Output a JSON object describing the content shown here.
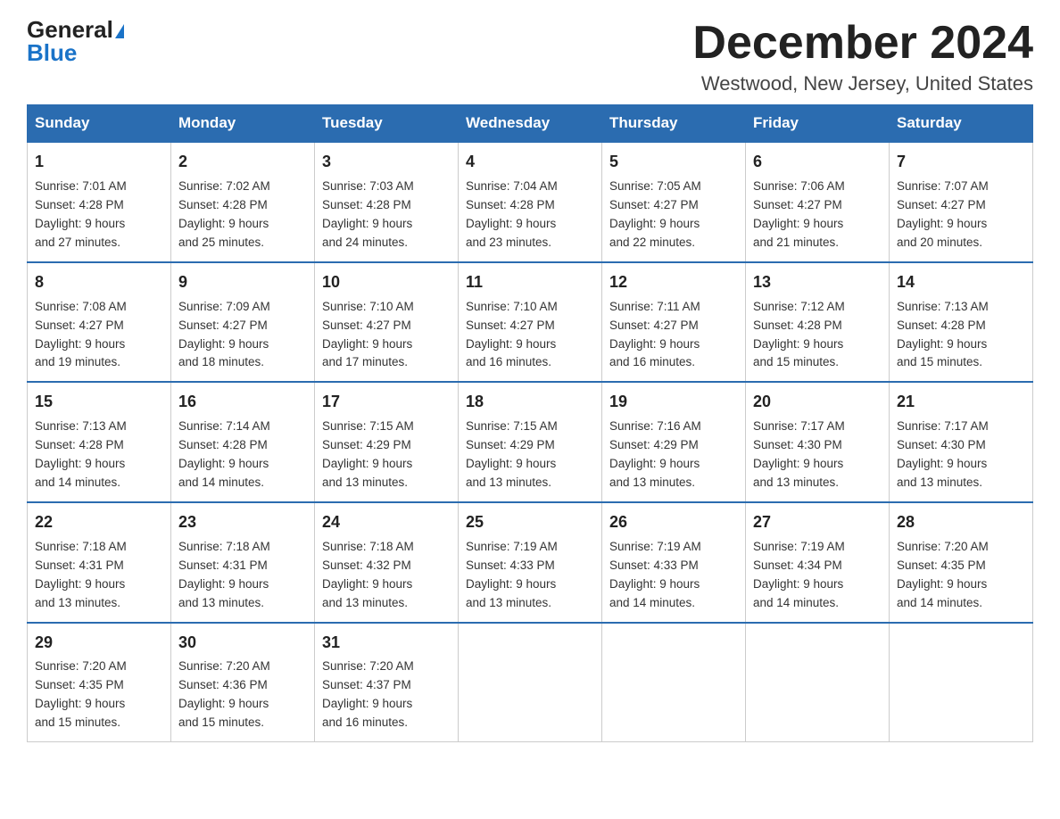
{
  "logo": {
    "general": "General",
    "blue": "Blue"
  },
  "header": {
    "month": "December 2024",
    "location": "Westwood, New Jersey, United States"
  },
  "days_of_week": [
    "Sunday",
    "Monday",
    "Tuesday",
    "Wednesday",
    "Thursday",
    "Friday",
    "Saturday"
  ],
  "weeks": [
    [
      {
        "day": "1",
        "sunrise": "7:01 AM",
        "sunset": "4:28 PM",
        "daylight": "9 hours and 27 minutes."
      },
      {
        "day": "2",
        "sunrise": "7:02 AM",
        "sunset": "4:28 PM",
        "daylight": "9 hours and 25 minutes."
      },
      {
        "day": "3",
        "sunrise": "7:03 AM",
        "sunset": "4:28 PM",
        "daylight": "9 hours and 24 minutes."
      },
      {
        "day": "4",
        "sunrise": "7:04 AM",
        "sunset": "4:28 PM",
        "daylight": "9 hours and 23 minutes."
      },
      {
        "day": "5",
        "sunrise": "7:05 AM",
        "sunset": "4:27 PM",
        "daylight": "9 hours and 22 minutes."
      },
      {
        "day": "6",
        "sunrise": "7:06 AM",
        "sunset": "4:27 PM",
        "daylight": "9 hours and 21 minutes."
      },
      {
        "day": "7",
        "sunrise": "7:07 AM",
        "sunset": "4:27 PM",
        "daylight": "9 hours and 20 minutes."
      }
    ],
    [
      {
        "day": "8",
        "sunrise": "7:08 AM",
        "sunset": "4:27 PM",
        "daylight": "9 hours and 19 minutes."
      },
      {
        "day": "9",
        "sunrise": "7:09 AM",
        "sunset": "4:27 PM",
        "daylight": "9 hours and 18 minutes."
      },
      {
        "day": "10",
        "sunrise": "7:10 AM",
        "sunset": "4:27 PM",
        "daylight": "9 hours and 17 minutes."
      },
      {
        "day": "11",
        "sunrise": "7:10 AM",
        "sunset": "4:27 PM",
        "daylight": "9 hours and 16 minutes."
      },
      {
        "day": "12",
        "sunrise": "7:11 AM",
        "sunset": "4:27 PM",
        "daylight": "9 hours and 16 minutes."
      },
      {
        "day": "13",
        "sunrise": "7:12 AM",
        "sunset": "4:28 PM",
        "daylight": "9 hours and 15 minutes."
      },
      {
        "day": "14",
        "sunrise": "7:13 AM",
        "sunset": "4:28 PM",
        "daylight": "9 hours and 15 minutes."
      }
    ],
    [
      {
        "day": "15",
        "sunrise": "7:13 AM",
        "sunset": "4:28 PM",
        "daylight": "9 hours and 14 minutes."
      },
      {
        "day": "16",
        "sunrise": "7:14 AM",
        "sunset": "4:28 PM",
        "daylight": "9 hours and 14 minutes."
      },
      {
        "day": "17",
        "sunrise": "7:15 AM",
        "sunset": "4:29 PM",
        "daylight": "9 hours and 13 minutes."
      },
      {
        "day": "18",
        "sunrise": "7:15 AM",
        "sunset": "4:29 PM",
        "daylight": "9 hours and 13 minutes."
      },
      {
        "day": "19",
        "sunrise": "7:16 AM",
        "sunset": "4:29 PM",
        "daylight": "9 hours and 13 minutes."
      },
      {
        "day": "20",
        "sunrise": "7:17 AM",
        "sunset": "4:30 PM",
        "daylight": "9 hours and 13 minutes."
      },
      {
        "day": "21",
        "sunrise": "7:17 AM",
        "sunset": "4:30 PM",
        "daylight": "9 hours and 13 minutes."
      }
    ],
    [
      {
        "day": "22",
        "sunrise": "7:18 AM",
        "sunset": "4:31 PM",
        "daylight": "9 hours and 13 minutes."
      },
      {
        "day": "23",
        "sunrise": "7:18 AM",
        "sunset": "4:31 PM",
        "daylight": "9 hours and 13 minutes."
      },
      {
        "day": "24",
        "sunrise": "7:18 AM",
        "sunset": "4:32 PM",
        "daylight": "9 hours and 13 minutes."
      },
      {
        "day": "25",
        "sunrise": "7:19 AM",
        "sunset": "4:33 PM",
        "daylight": "9 hours and 13 minutes."
      },
      {
        "day": "26",
        "sunrise": "7:19 AM",
        "sunset": "4:33 PM",
        "daylight": "9 hours and 14 minutes."
      },
      {
        "day": "27",
        "sunrise": "7:19 AM",
        "sunset": "4:34 PM",
        "daylight": "9 hours and 14 minutes."
      },
      {
        "day": "28",
        "sunrise": "7:20 AM",
        "sunset": "4:35 PM",
        "daylight": "9 hours and 14 minutes."
      }
    ],
    [
      {
        "day": "29",
        "sunrise": "7:20 AM",
        "sunset": "4:35 PM",
        "daylight": "9 hours and 15 minutes."
      },
      {
        "day": "30",
        "sunrise": "7:20 AM",
        "sunset": "4:36 PM",
        "daylight": "9 hours and 15 minutes."
      },
      {
        "day": "31",
        "sunrise": "7:20 AM",
        "sunset": "4:37 PM",
        "daylight": "9 hours and 16 minutes."
      },
      null,
      null,
      null,
      null
    ]
  ],
  "labels": {
    "sunrise": "Sunrise:",
    "sunset": "Sunset:",
    "daylight": "Daylight:"
  }
}
